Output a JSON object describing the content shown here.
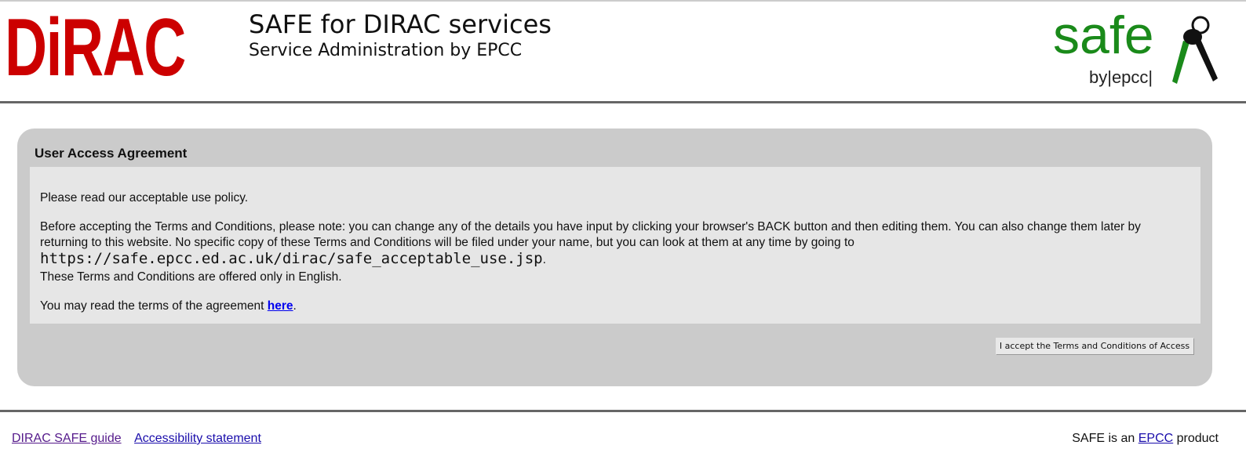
{
  "header": {
    "logo_text": "DiRAC",
    "title": "SAFE for DIRAC services",
    "subtitle": "Service Administration by EPCC",
    "safe_logo": "safe",
    "safe_by": "by|epcc|"
  },
  "panel": {
    "title": "User Access Agreement",
    "p1": "Please read our acceptable use policy.",
    "p2": "Before accepting the Terms and Conditions, please note: you can change any of the details you have input by clicking your browser's BACK button and then editing them. You can also change them later by returning to this website. No specific copy of these Terms and Conditions will be filed under your name, but you can look at them at any time by going to",
    "url": "https://safe.epcc.ed.ac.uk/dirac/safe_acceptable_use.jsp",
    "p3": "These Terms and Conditions are offered only in English.",
    "p4_pre": "You may read the terms of the agreement ",
    "p4_link": "here",
    "accept_button": "I accept the Terms and Conditions of Access"
  },
  "footer": {
    "guide": "DIRAC SAFE guide",
    "accessibility": "Accessibility statement",
    "product_pre": "SAFE is an ",
    "product_link": "EPCC",
    "product_post": " product"
  }
}
